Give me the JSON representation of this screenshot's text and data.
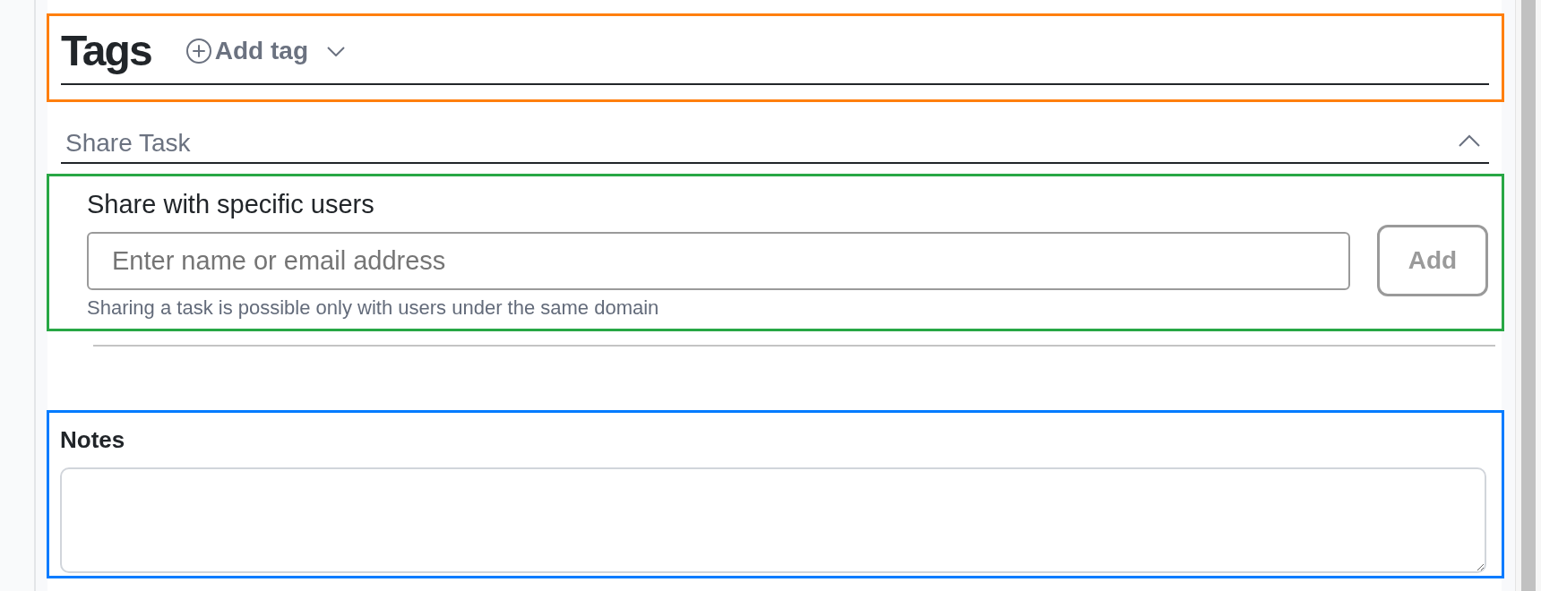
{
  "tags": {
    "title": "Tags",
    "add_tag": {
      "label": "Add tag"
    },
    "color": "#ff7f0e"
  },
  "share_task": {
    "title": "Share Task",
    "expanded": true,
    "specific_users": {
      "label": "Share with specific users",
      "input": {
        "placeholder": "Enter name or email address"
      },
      "add_button": {
        "label": "Add",
        "disabled": true
      },
      "hint": "Sharing a task is possible only with users under the same domain",
      "color": "#28a745"
    }
  },
  "notes": {
    "label": "Notes",
    "color": "#007bff"
  }
}
